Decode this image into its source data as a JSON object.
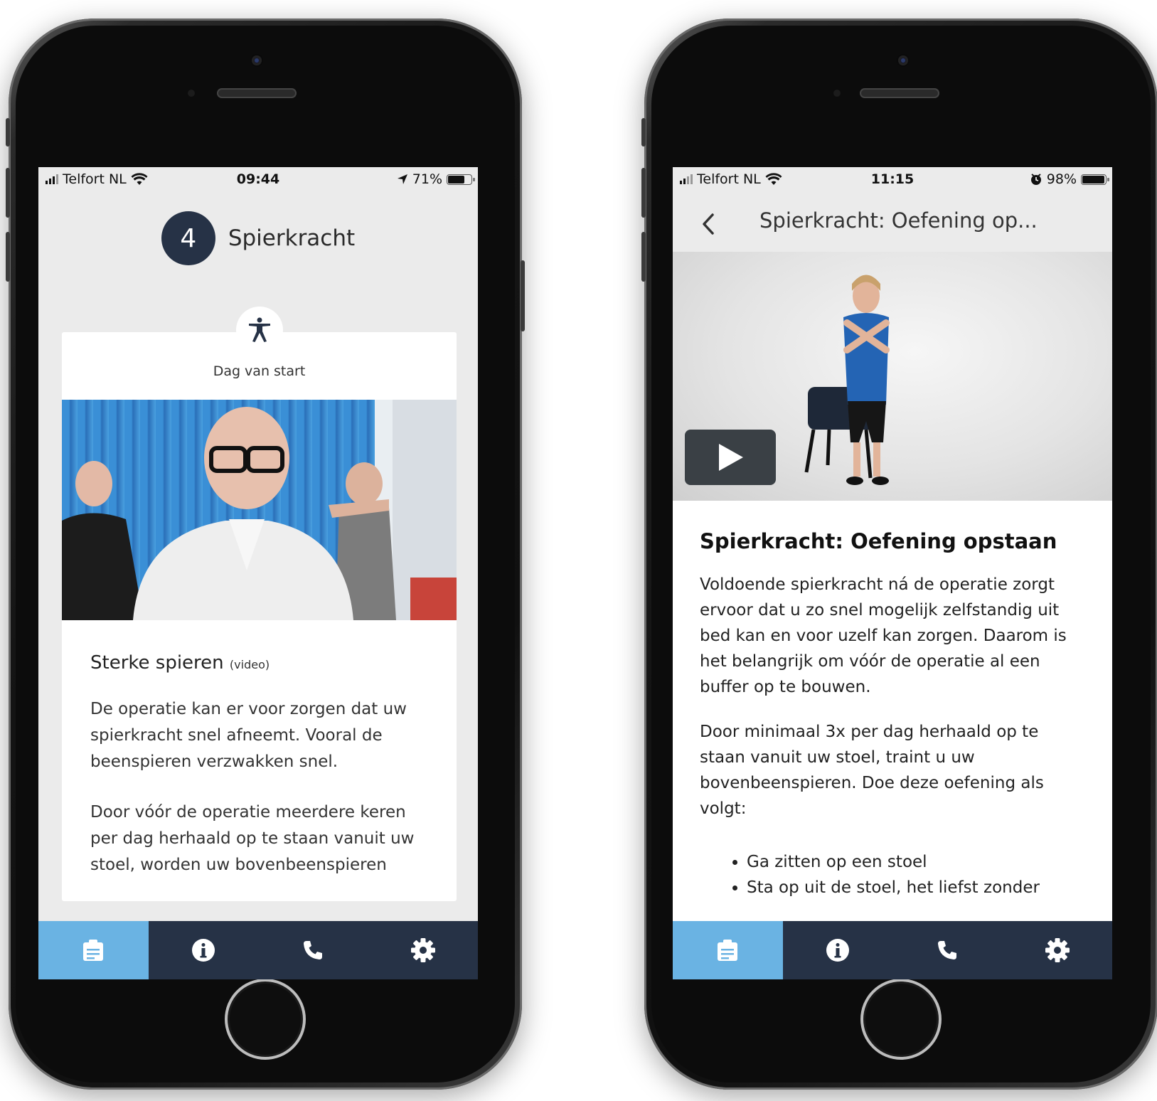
{
  "left_phone": {
    "status": {
      "carrier": "Telfort NL",
      "time": "09:44",
      "battery": "71%",
      "battery_level": 0.71
    },
    "step": {
      "number": "4",
      "title": "Spierkracht"
    },
    "card": {
      "label": "Dag van start",
      "heading": "Sterke spieren",
      "heading_note": "(video)",
      "paragraphs": [
        "De operatie kan er voor zorgen dat uw spierkracht snel afneemt. Vooral de beenspieren verzwakken snel.",
        "Door vóór de operatie meerdere keren per dag herhaald op te staan vanuit uw stoel, worden uw bovenbeenspieren"
      ]
    }
  },
  "right_phone": {
    "status": {
      "carrier": "Telfort NL",
      "time": "11:15",
      "battery": "98%",
      "battery_level": 0.98
    },
    "nav": {
      "title": "Spierkracht: Oefening op..."
    },
    "content": {
      "heading": "Spierkracht: Oefening opstaan",
      "paragraphs": [
        "Voldoende spierkracht ná de operatie zorgt ervoor dat u zo snel mogelijk zelfstandig uit bed kan en voor uzelf kan zorgen. Daarom is het belangrijk om vóór de operatie al een buffer op te bouwen.",
        "Door minimaal 3x per dag herhaald op te staan vanuit uw stoel, traint u uw bovenbeenspieren. Doe deze oefening als volgt:"
      ],
      "list": [
        "Ga zitten op een stoel",
        "Sta op uit de stoel, het liefst zonder"
      ]
    }
  },
  "tabbar": {
    "tabs": [
      {
        "icon": "clipboard-icon",
        "active": true
      },
      {
        "icon": "info-icon",
        "active": false
      },
      {
        "icon": "phone-icon",
        "active": false
      },
      {
        "icon": "gear-icon",
        "active": false
      }
    ]
  },
  "colors": {
    "navy": "#263246",
    "active_tab": "#6ab3e3",
    "screen_bg": "#ebebeb"
  }
}
